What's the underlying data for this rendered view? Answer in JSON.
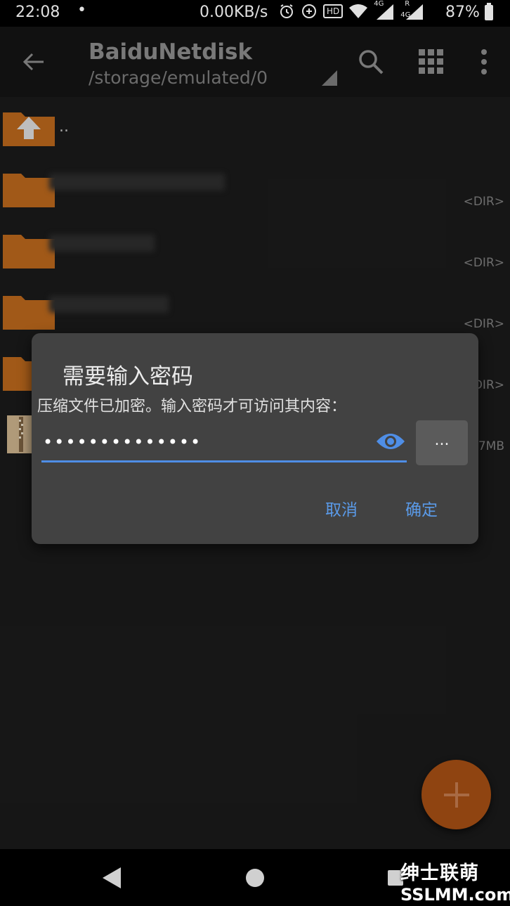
{
  "status_bar": {
    "time": "22:08",
    "dot": "•",
    "network_speed": "0.00KB/s",
    "battery": "87%",
    "icons": [
      "alarm-icon",
      "data-saver-icon",
      "hd-icon",
      "wifi-icon",
      "signal-4g-icon",
      "signal-4g-roaming-icon",
      "battery-icon"
    ],
    "net_label_1": "4G",
    "net_label_2": "4G",
    "roaming_label": "R",
    "hd_label": "HD"
  },
  "app_bar": {
    "title": "BaiduNetdisk",
    "path": "/storage/emulated/0"
  },
  "file_list": {
    "parent_label": "..",
    "rows": [
      {
        "meta": "<DIR>"
      },
      {
        "meta": "<DIR>"
      },
      {
        "meta": "<DIR>"
      },
      {
        "meta": "<DIR>"
      },
      {
        "meta": "7MB"
      }
    ]
  },
  "dialog": {
    "title": "需要输入密码",
    "message": "压缩文件已加密。输入密码才可访问其内容：",
    "password_value": "••••••••••••••",
    "browse_label": "...",
    "cancel_label": "取消",
    "ok_label": "确定"
  },
  "watermark": {
    "line1": "绅士联萌",
    "line2": "SSLMM.com"
  },
  "colors": {
    "accent": "#5a9ae8",
    "folder": "#b8661c",
    "fab": "#8f4411",
    "dialog_bg": "#424242"
  }
}
